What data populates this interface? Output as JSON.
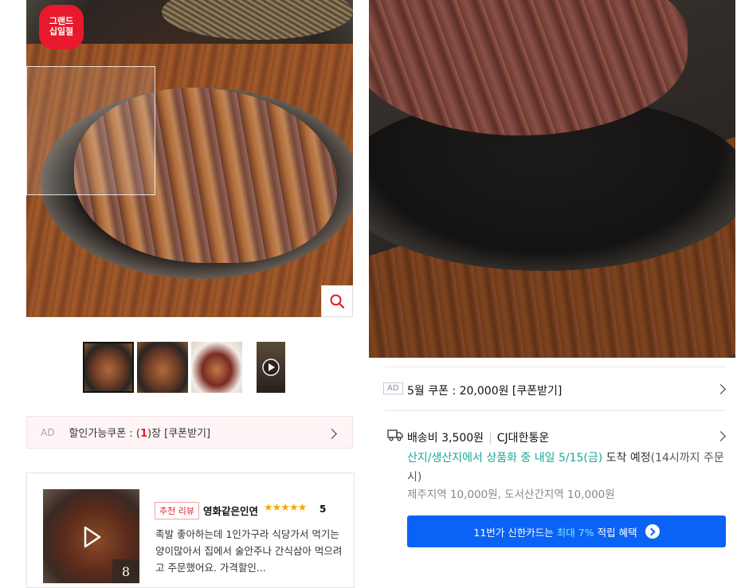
{
  "product_gallery": {
    "badge_lines": [
      "그랜드",
      "십일절"
    ],
    "thumbnails": [
      "thumb-1",
      "thumb-2",
      "thumb-3",
      "video"
    ]
  },
  "coupon_bar": {
    "ad_label": "AD",
    "prefix": "할인가능쿠폰 : (",
    "count": "1",
    "suffix": ")장 [쿠폰받기]"
  },
  "review": {
    "media_count": "8",
    "tag": "추천 리뷰",
    "user": "영화같은인연",
    "stars": "★★★★★",
    "score": "5",
    "text": "족발 좋아하는데 1인가구라 식당가서 먹기는 양이많아서 집에서 술안주나 간식삼아 먹으려고 주문했어요. 가격할인..."
  },
  "info_panel": {
    "ad_label": "AD",
    "coupon": "5월 쿠폰 : 20,000원 [쿠폰받기]",
    "shipping_fee": "배송비 3,500원",
    "carrier": "CJ대한통운",
    "arrival_teal": "산지/생산지에서 상품화 중 내일 5/15(금)",
    "arrival_rest": " 도착 예정",
    "arrival_note": "(14시까지 주문 시)",
    "extra_fee": "제주지역 10,000원, 도서산간지역 10,000원",
    "card_pre": "11번가 신한카드는",
    "card_hl": "최대 7%",
    "card_post": "적립 혜택"
  },
  "colors": {
    "brand_red": "#e8192c",
    "teal": "#1aa89a",
    "blue_button": "#0b63f5"
  }
}
